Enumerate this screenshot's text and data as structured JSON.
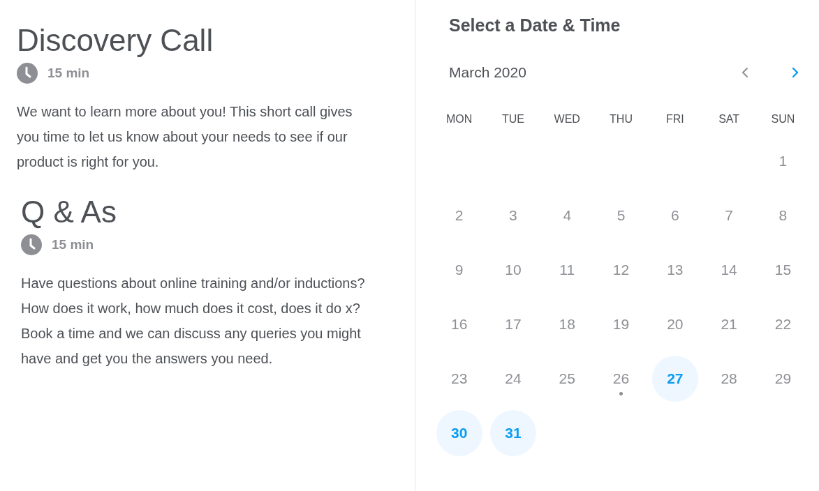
{
  "events": [
    {
      "title": "Discovery Call",
      "duration": "15 min",
      "paragraphs": [
        "We want to learn more about you! This short call gives you time to let us know about your needs to see if our product is right for you."
      ]
    },
    {
      "title": "Q & As",
      "duration": "15 min",
      "paragraphs": [
        "Have questions about online training and/or inductions? How does it work, how much does it cost, does it do x?",
        "Book a time and we can discuss any queries you might have and get you the answers you need."
      ]
    }
  ],
  "calendar": {
    "heading": "Select a Date & Time",
    "month": "March 2020",
    "prev": {
      "disabled": true
    },
    "next": {
      "disabled": false
    },
    "weekdays": [
      "MON",
      "TUE",
      "WED",
      "THU",
      "FRI",
      "SAT",
      "SUN"
    ],
    "weeks": [
      [
        {
          "kind": "blank"
        },
        {
          "kind": "blank"
        },
        {
          "kind": "blank"
        },
        {
          "kind": "blank"
        },
        {
          "kind": "blank"
        },
        {
          "kind": "blank"
        },
        {
          "kind": "day",
          "day": "1",
          "available": false,
          "today": false
        }
      ],
      [
        {
          "day": "2",
          "available": false,
          "today": false
        },
        {
          "day": "3",
          "available": false,
          "today": false
        },
        {
          "day": "4",
          "available": false,
          "today": false
        },
        {
          "day": "5",
          "available": false,
          "today": false
        },
        {
          "day": "6",
          "available": false,
          "today": false
        },
        {
          "day": "7",
          "available": false,
          "today": false
        },
        {
          "day": "8",
          "available": false,
          "today": false
        }
      ],
      [
        {
          "day": "9",
          "available": false,
          "today": false
        },
        {
          "day": "10",
          "available": false,
          "today": false
        },
        {
          "day": "11",
          "available": false,
          "today": false
        },
        {
          "day": "12",
          "available": false,
          "today": false
        },
        {
          "day": "13",
          "available": false,
          "today": false
        },
        {
          "day": "14",
          "available": false,
          "today": false
        },
        {
          "day": "15",
          "available": false,
          "today": false
        }
      ],
      [
        {
          "day": "16",
          "available": false,
          "today": false
        },
        {
          "day": "17",
          "available": false,
          "today": false
        },
        {
          "day": "18",
          "available": false,
          "today": false
        },
        {
          "day": "19",
          "available": false,
          "today": false
        },
        {
          "day": "20",
          "available": false,
          "today": false
        },
        {
          "day": "21",
          "available": false,
          "today": false
        },
        {
          "day": "22",
          "available": false,
          "today": false
        }
      ],
      [
        {
          "day": "23",
          "available": false,
          "today": false
        },
        {
          "day": "24",
          "available": false,
          "today": false
        },
        {
          "day": "25",
          "available": false,
          "today": false
        },
        {
          "day": "26",
          "available": false,
          "today": true
        },
        {
          "day": "27",
          "available": true,
          "today": false
        },
        {
          "day": "28",
          "available": false,
          "today": false
        },
        {
          "day": "29",
          "available": false,
          "today": false
        }
      ],
      [
        {
          "day": "30",
          "available": true,
          "today": false
        },
        {
          "day": "31",
          "available": true,
          "today": false
        }
      ]
    ]
  }
}
